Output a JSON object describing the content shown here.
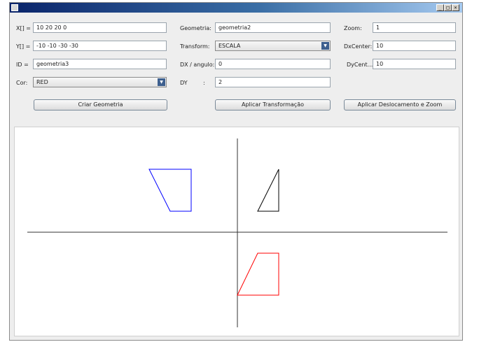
{
  "window": {
    "title": "",
    "controls": {
      "minimize": "_",
      "maximize": "□",
      "close": "×"
    }
  },
  "form": {
    "x_label": "X[] =",
    "x_value": "10 20 20 0",
    "y_label": "Y[] =",
    "y_value": "-10 -10 -30 -30",
    "id_label": "ID =",
    "id_value": "geometria3",
    "cor_label": "Cor:",
    "cor_value": "RED",
    "geometria_label": "Geometria:",
    "geometria_value": "geometria2",
    "transform_label": "Transform:",
    "transform_value": "ESCALA",
    "dx_label": "DX / angulo:",
    "dx_value": "0",
    "dy_label": "DY",
    "dy_colon": ":",
    "dy_value": "2",
    "zoom_label": "Zoom:",
    "zoom_value": "1",
    "dxcenter_label": "DxCenter:",
    "dxcenter_value": "10",
    "dycenter_label": "DyCent...",
    "dycenter_value": "10"
  },
  "buttons": {
    "criar": "Criar Geometria",
    "aplicar_transformacao": "Aplicar Transformação",
    "aplicar_deslocamento": "Aplicar Deslocamento e Zoom"
  },
  "shape_colors": {
    "blue": "#0000ff",
    "black": "#000000",
    "red": "#ff0000"
  }
}
